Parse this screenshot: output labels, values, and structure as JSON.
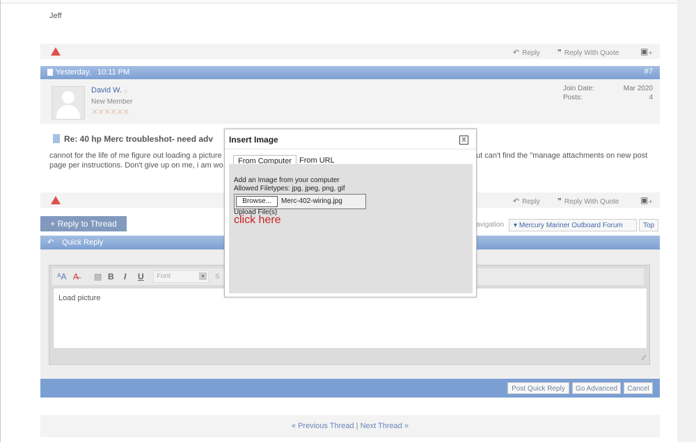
{
  "prev_post": {
    "author_signoff": "Jeff",
    "actions": {
      "reply": "Reply",
      "reply_with_quote": "Reply With Quote"
    }
  },
  "post": {
    "date": "Yesterday,",
    "time": "10:11 PM",
    "number": "#7",
    "user": {
      "name": "David W.",
      "title": "New Member"
    },
    "join_date_label": "Join Date:",
    "join_date_value": "Mar 2020",
    "posts_label": "Posts:",
    "posts_value": "4",
    "title": "Re: 40 hp Merc troubleshot- need adv",
    "body_line1_left": "cannot for the life of me figure out loading a picture",
    "body_line1_right": "ut can't find the \"manage attachments on new post",
    "body_line2_left": "page per instructions. Don't give up on me, i am wo",
    "actions": {
      "reply": "Reply",
      "reply_with_quote": "Reply With Quote"
    }
  },
  "thread_controls": {
    "reply_to_thread": "+ Reply to Thread",
    "navigation_fragment": "avigation",
    "forum_select": "Mercury Mariner Outboard Forum",
    "top": "Top"
  },
  "quick_reply": {
    "title": "Quick Reply",
    "font_placeholder": "Font",
    "size_fragment": "S",
    "editor_text": "Load picture",
    "buttons": {
      "post": "Post Quick Reply",
      "advanced": "Go Advanced",
      "cancel": "Cancel"
    }
  },
  "thread_nav": {
    "previous": "« Previous Thread",
    "separator": "|",
    "next": "Next Thread »"
  },
  "modal": {
    "title": "Insert Image",
    "close": "X",
    "tabs": [
      "From Computer",
      "From URL"
    ],
    "line1": "Add an Image from your computer",
    "line2": "Allowed Filetypes: jpg, jpeg, png, gif",
    "browse": "Browse...",
    "filename": "Merc-402-wiring.jpg",
    "upload_label": "Upload File(s)",
    "annotation": "click here"
  },
  "colors": {
    "header_blue": "#7d9fd2",
    "warning_red": "#e0504e",
    "annotation_red": "#cc1f1f"
  }
}
